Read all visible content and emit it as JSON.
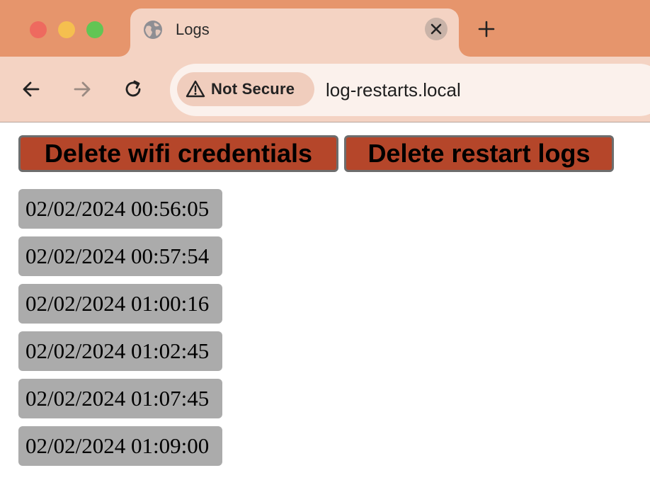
{
  "browser": {
    "tab": {
      "title": "Logs",
      "favicon": "globe-icon",
      "close_icon": "close-icon"
    },
    "new_tab_icon": "plus-icon",
    "nav": {
      "back_icon": "arrow-left-icon",
      "forward_icon": "arrow-right-icon",
      "reload_icon": "reload-icon"
    },
    "security": {
      "label": "Not Secure",
      "icon": "warning-triangle-icon"
    },
    "url": "log-restarts.local"
  },
  "page": {
    "buttons": {
      "delete_wifi": "Delete wifi credentials",
      "delete_logs": "Delete restart logs"
    },
    "logs": [
      "02/02/2024 00:56:05",
      "02/02/2024 00:57:54",
      "02/02/2024 01:00:16",
      "02/02/2024 01:02:45",
      "02/02/2024 01:07:45",
      "02/02/2024 01:09:00"
    ]
  },
  "colors": {
    "tabstrip": "#e6956c",
    "toolbar": "#f4d3c3",
    "button_bg": "#b5462a",
    "log_bg": "#ababab"
  }
}
